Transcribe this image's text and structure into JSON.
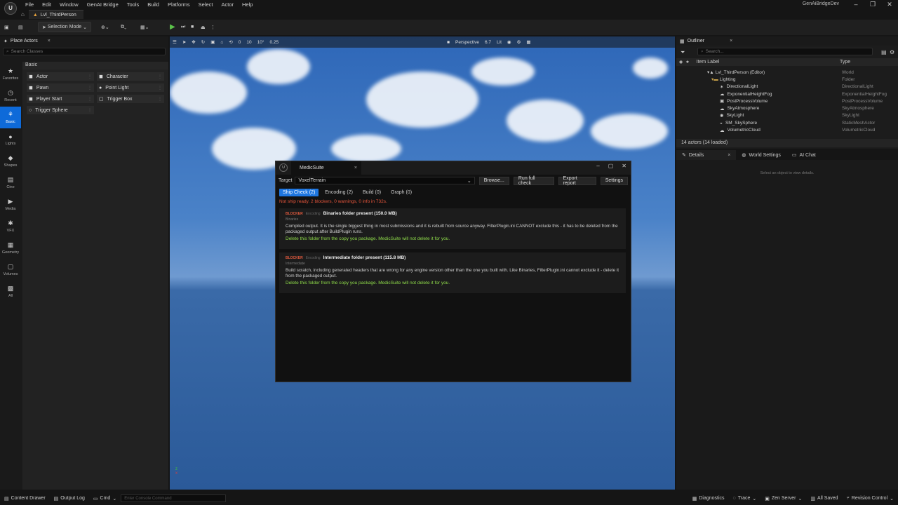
{
  "menu": [
    "File",
    "Edit",
    "Window",
    "GenAI Bridge",
    "Tools",
    "Build",
    "Platforms",
    "Select",
    "Actor",
    "Help"
  ],
  "project_name": "GenAiBridgeDev",
  "level_tab": "Lvl_ThirdPerson",
  "toolbar": {
    "selection_mode": "Selection Mode"
  },
  "place_actors": {
    "title": "Place Actors",
    "search_placeholder": "Search Classes",
    "section": "Basic",
    "categories": [
      "Favorites",
      "Recent",
      "Basic",
      "Lights",
      "Shapes",
      "Cine",
      "Media",
      "VFX",
      "Geometry",
      "Volumes",
      "All"
    ],
    "items": [
      "Actor",
      "Character",
      "Pawn",
      "Point Light",
      "Player Start",
      "Trigger Box",
      "Trigger Sphere"
    ]
  },
  "viewport": {
    "perspective": "Perspective",
    "lit": "Lit",
    "fov": "6.7",
    "snap_grid": "10",
    "snap_rot": "10°",
    "snap_scale": "0.25",
    "zero": "0"
  },
  "outliner": {
    "title": "Outliner",
    "search_placeholder": "Search...",
    "col_label": "Item Label",
    "col_type": "Type",
    "rows": [
      {
        "label": "Lvl_ThirdPerson (Editor)",
        "type": "World"
      },
      {
        "label": "Lighting",
        "type": "Folder"
      },
      {
        "label": "DirectionalLight",
        "type": "DirectionalLight"
      },
      {
        "label": "ExponentialHeightFog",
        "type": "ExponentialHeightFog"
      },
      {
        "label": "PostProcessVolume",
        "type": "PostProcessVolume"
      },
      {
        "label": "SkyAtmosphere",
        "type": "SkyAtmosphere"
      },
      {
        "label": "SkyLight",
        "type": "SkyLight"
      },
      {
        "label": "SM_SkySphere",
        "type": "StaticMeshActor"
      },
      {
        "label": "VolumetricCloud",
        "type": "VolumetricCloud"
      }
    ],
    "count": "14 actors (14 loaded)"
  },
  "details": {
    "tab_details": "Details",
    "tab_world": "World Settings",
    "tab_chat": "AI Chat",
    "empty": "Select an object to view details."
  },
  "dialog": {
    "title": "MedicSuite",
    "target_label": "Target",
    "target_value": "VoxelTerrain",
    "buttons": [
      "Browse...",
      "Run full check",
      "Export report",
      "Settings"
    ],
    "tabs": [
      "Ship Check (2)",
      "Encoding (2)",
      "Build (0)",
      "Graph (0)"
    ],
    "summary": "Not ship ready.  2 blockers, 0 warnings, 0 info in 732s.",
    "issues": [
      {
        "severity": "BLOCKER",
        "category": "Encoding",
        "title": "Binaries folder present (150.0 MB)",
        "path": "Binaries",
        "desc": "Compiled output. It is the single biggest thing in most submissions and it is rebuilt from source anyway. FilterPlugin.ini CANNOT exclude this - it has to be deleted from the packaged output after BuildPlugin runs.",
        "fix": "Delete this folder from the copy you package. MedicSuite will not delete it for you."
      },
      {
        "severity": "BLOCKER",
        "category": "Encoding",
        "title": "Intermediate folder present (115.8 MB)",
        "path": "Intermediate",
        "desc": "Build scratch, including generated headers that are wrong for any engine version other than the one you built with. Like Binaries, FilterPlugin.ini cannot exclude it - delete it from the packaged output.",
        "fix": "Delete this folder from the copy you package. MedicSuite will not delete it for you."
      }
    ]
  },
  "statusbar": {
    "content_drawer": "Content Drawer",
    "output_log": "Output Log",
    "cmd": "Cmd",
    "console_placeholder": "Enter Console Command",
    "diagnostics": "Diagnostics",
    "trace": "Trace",
    "zen": "Zen Server",
    "saved": "All Saved",
    "revision": "Revision Control"
  }
}
